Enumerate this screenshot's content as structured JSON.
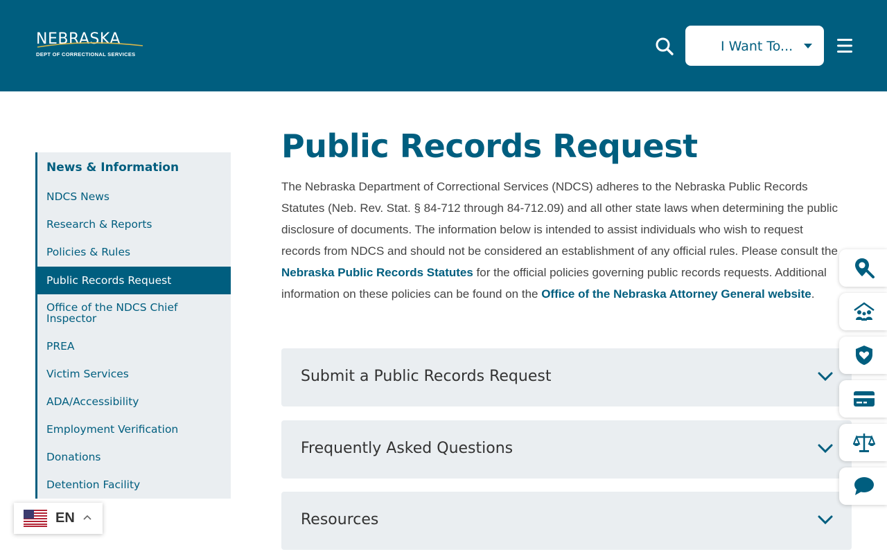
{
  "header": {
    "logo_word": "NEBRASKA",
    "logo_sub": "DEPT OF CORRECTIONAL SERVICES",
    "search_icon": "search-icon",
    "iwant_label": "I Want To...",
    "menu_icon": "hamburger-menu-icon"
  },
  "sidebar": {
    "heading": "News & Information",
    "items": [
      {
        "label": "NDCS News"
      },
      {
        "label": "Research & Reports"
      },
      {
        "label": "Policies & Rules"
      },
      {
        "label": "Public Records Request",
        "active": true
      },
      {
        "label": "Office of the NDCS Chief Inspector"
      },
      {
        "label": "PREA"
      },
      {
        "label": "Victim Services"
      },
      {
        "label": "ADA/Accessibility"
      },
      {
        "label": "Employment Verification"
      },
      {
        "label": "Donations"
      },
      {
        "label": "Detention Facility"
      }
    ]
  },
  "main": {
    "title": "Public Records Request",
    "intro_part1": "The Nebraska Department of Correctional Services (NDCS) adheres to the Nebraska Public Records Statutes (Neb. Rev. Stat. § 84-712 through 84-712.09) and all other state laws when determining the public disclosure of documents.  The information below is intended to assist individuals who wish to request records from NDCS and should not be considered an establishment of any official rules.  Please consult the ",
    "intro_link1": "Nebraska Public Records Statutes",
    "intro_part2": " for the official policies governing public records requests. Additional information on these policies can be found on the ",
    "intro_link2": "Office of the Nebraska Attorney General website",
    "intro_part3": ".",
    "accordions": [
      {
        "label": "Submit a Public Records Request"
      },
      {
        "label": "Frequently Asked Questions"
      },
      {
        "label": "Resources"
      }
    ]
  },
  "language": {
    "code": "EN",
    "flag_icon": "us-flag-icon"
  },
  "quick_links": [
    {
      "icon": "map-search-icon"
    },
    {
      "icon": "family-home-icon"
    },
    {
      "icon": "shield-heart-icon"
    },
    {
      "icon": "credit-card-icon"
    },
    {
      "icon": "scales-icon"
    },
    {
      "icon": "chat-bubble-icon"
    }
  ],
  "colors": {
    "brand": "#005e7f",
    "panel": "#eaeef1",
    "text": "#444444"
  }
}
